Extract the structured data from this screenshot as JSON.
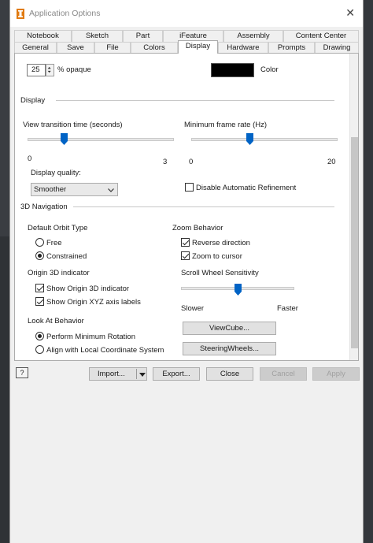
{
  "window": {
    "title": "Application Options"
  },
  "tabs_row1": [
    "Notebook",
    "Sketch",
    "Part",
    "iFeature",
    "Assembly",
    "Content Center"
  ],
  "tabs_row2": [
    "General",
    "Save",
    "File",
    "Colors",
    "Display",
    "Hardware",
    "Prompts",
    "Drawing"
  ],
  "active_tab": "Display",
  "opacity": {
    "value": "25",
    "suffix": "% opaque"
  },
  "color_label": "Color",
  "display_section": "Display",
  "view_transition": {
    "label": "View transition time (seconds)",
    "min": "0",
    "max": "3",
    "level": 0.25
  },
  "min_frame_rate": {
    "label": "Minimum frame rate (Hz)",
    "min": "0",
    "max": "20",
    "level": 0.4
  },
  "display_quality": {
    "label": "Display quality:",
    "value": "Smoother"
  },
  "disable_refinement": {
    "label": "Disable Automatic Refinement",
    "checked": false
  },
  "nav_section": "3D Navigation",
  "orbit": {
    "label": "Default Orbit Type",
    "free": "Free",
    "constrained": "Constrained",
    "selected": "Constrained"
  },
  "origin": {
    "label": "Origin 3D indicator",
    "show_indicator": "Show Origin 3D indicator",
    "show_labels": "Show Origin XYZ axis labels"
  },
  "look_at": {
    "label": "Look At Behavior",
    "min_rotation": "Perform Minimum Rotation",
    "align": "Align with Local Coordinate System",
    "selected": "Perform Minimum Rotation"
  },
  "zoom": {
    "label": "Zoom Behavior",
    "reverse": "Reverse direction",
    "to_cursor": "Zoom to cursor"
  },
  "scroll_wheel": {
    "label": "Scroll Wheel Sensitivity",
    "slower": "Slower",
    "faster": "Faster",
    "level": 0.5
  },
  "buttons": {
    "viewcube": "ViewCube...",
    "steeringwheels": "SteeringWheels..."
  },
  "footer": {
    "help": "?",
    "import": "Import...",
    "export": "Export...",
    "close": "Close",
    "cancel": "Cancel",
    "apply": "Apply"
  }
}
